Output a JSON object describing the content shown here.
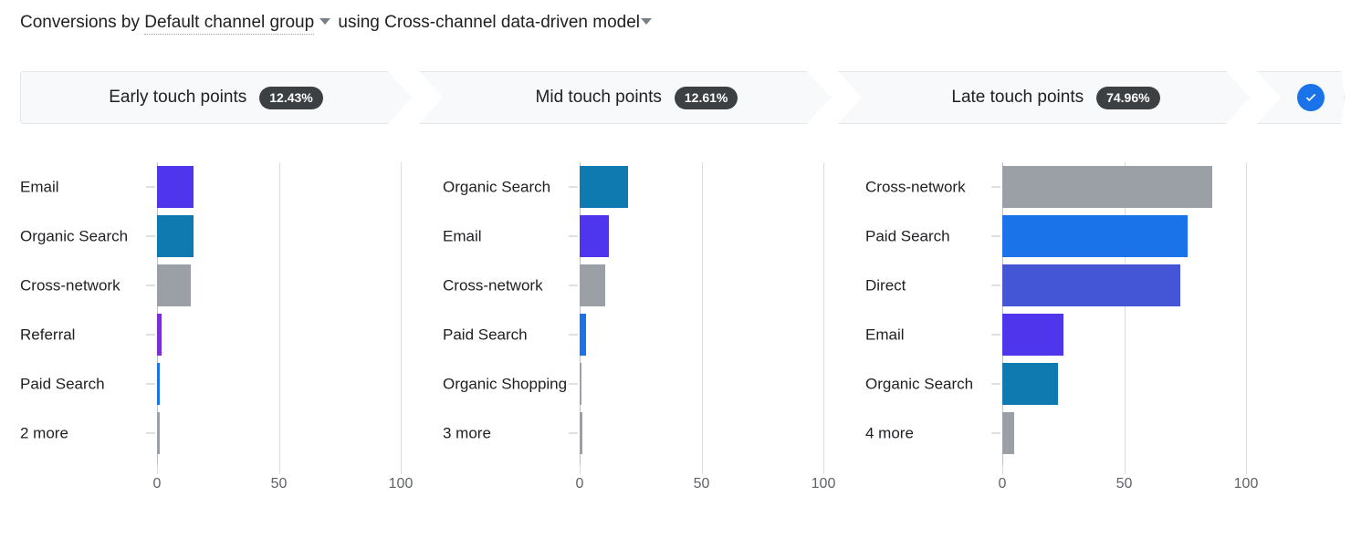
{
  "title": {
    "prefix": "Conversions by ",
    "dimension": "Default channel group",
    "middle": " using ",
    "model": "Cross-channel data-driven model",
    "dimension_caret_icon": "chevron-down-icon",
    "model_caret_icon": "chevron-down-icon"
  },
  "steps": [
    {
      "label": "Early touch points",
      "badge": "12.43%"
    },
    {
      "label": "Mid touch points",
      "badge": "12.61%"
    },
    {
      "label": "Late touch points",
      "badge": "74.96%"
    }
  ],
  "confirm_icon": "check-circle-icon",
  "colors": {
    "email": "#4f35ec",
    "organic_search": "#0f7ab0",
    "cross_network": "#9aa0a6",
    "referral": "#7b2fd4",
    "paid_search": "#1a73e8",
    "direct": "#4455d6",
    "other": "#9aa0a6",
    "badge_bg": "#3c4043",
    "check_bg": "#1a73e8",
    "step_bg": "#f8f9fa",
    "gridline": "#dadce0"
  },
  "chart_data": [
    {
      "type": "bar",
      "title": "Early touch points",
      "orientation": "horizontal",
      "xlabel": "",
      "ylabel": "",
      "xlim": [
        0,
        110
      ],
      "ticks": [
        "0",
        "50",
        "100"
      ],
      "tick_values": [
        0,
        50,
        100
      ],
      "grid": true,
      "categories": [
        "Email",
        "Organic Search",
        "Cross-network",
        "Referral",
        "Paid Search",
        "2 more"
      ],
      "values": [
        15,
        15,
        14,
        2,
        1,
        1
      ],
      "colors": [
        "#4f35ec",
        "#0f7ab0",
        "#9aa0a6",
        "#7b2fd4",
        "#1a73e8",
        "#9aa0a6"
      ]
    },
    {
      "type": "bar",
      "title": "Mid touch points",
      "orientation": "horizontal",
      "xlabel": "",
      "ylabel": "",
      "xlim": [
        0,
        110
      ],
      "ticks": [
        "0",
        "50",
        "100"
      ],
      "tick_values": [
        0,
        50,
        100
      ],
      "grid": true,
      "categories": [
        "Organic Search",
        "Email",
        "Cross-network",
        "Paid Search",
        "Organic Shopping",
        "3 more"
      ],
      "values": [
        20,
        12,
        10.5,
        2.5,
        0.3,
        1
      ],
      "colors": [
        "#0f7ab0",
        "#4f35ec",
        "#9aa0a6",
        "#1a73e8",
        "#9aa0a6",
        "#9aa0a6"
      ]
    },
    {
      "type": "bar",
      "title": "Late touch points",
      "orientation": "horizontal",
      "xlabel": "",
      "ylabel": "",
      "xlim": [
        0,
        110
      ],
      "ticks": [
        "0",
        "50",
        "100"
      ],
      "tick_values": [
        0,
        50,
        100
      ],
      "grid": true,
      "categories": [
        "Cross-network",
        "Paid Search",
        "Direct",
        "Email",
        "Organic Search",
        "4 more"
      ],
      "values": [
        86,
        76,
        73,
        25,
        23,
        5
      ],
      "colors": [
        "#9aa0a6",
        "#1a73e8",
        "#4455d6",
        "#4f35ec",
        "#0f7ab0",
        "#9aa0a6"
      ]
    }
  ]
}
